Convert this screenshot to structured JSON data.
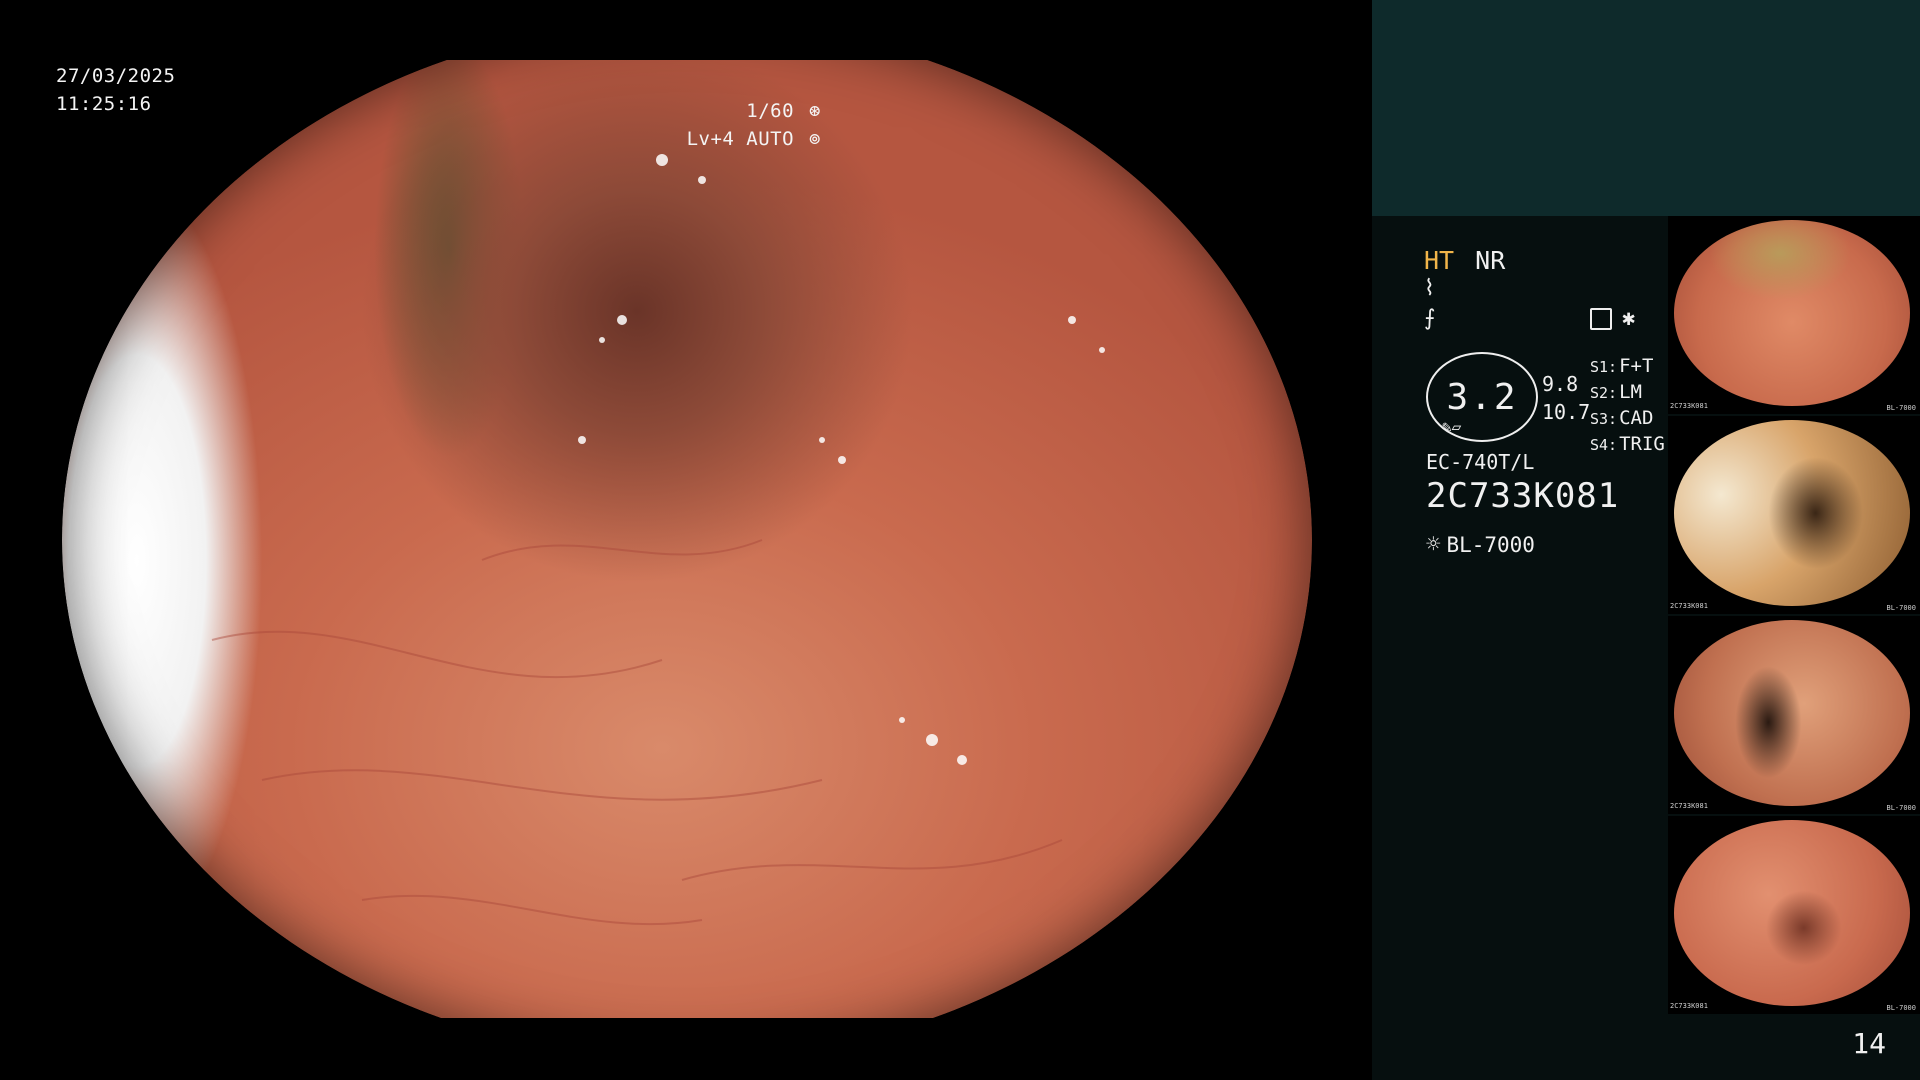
{
  "overlay": {
    "date": "27/03/2025",
    "time": "11:25:16",
    "shutter": "1/60",
    "iris": "Lv+4 AUTO"
  },
  "panel": {
    "mode_ht": "HT",
    "mode_nr": "NR",
    "enhancement_value": "3.2",
    "value_a": "9.8",
    "value_b": "10.7",
    "switches": [
      {
        "key": "S1:",
        "value": "F+T"
      },
      {
        "key": "S2:",
        "value": "LM"
      },
      {
        "key": "S3:",
        "value": "CAD"
      },
      {
        "key": "S4:",
        "value": "TRIG"
      }
    ],
    "scope_model": "EC-740T/L",
    "scope_serial": "2C733K081",
    "light_source": "BL-7000"
  },
  "thumbnails": [
    {
      "serial": "2C733K081",
      "source": "BL-7000"
    },
    {
      "serial": "2C733K081",
      "source": "BL-7000"
    },
    {
      "serial": "2C733K081",
      "source": "BL-7000"
    },
    {
      "serial": "2C733K081",
      "source": "BL-7000"
    }
  ],
  "page_number": "14",
  "colors": {
    "panel_bg": "#060f0f",
    "panel_top": "#0e2a2b",
    "ht_accent": "#f1b54a",
    "mucosa": "#c8684f"
  }
}
